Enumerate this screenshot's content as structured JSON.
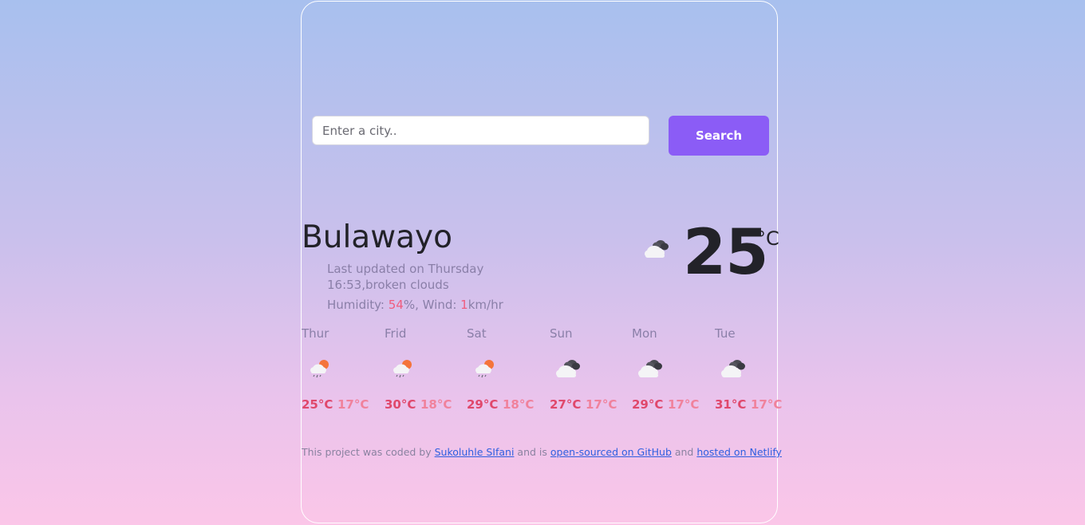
{
  "search": {
    "placeholder": "Enter a city..",
    "value": "",
    "button_label": "Search"
  },
  "current": {
    "city": "Bulawayo",
    "updated_prefix": "Last updated on Thursday",
    "updated_time": "16:53",
    "description": "broken clouds",
    "humidity_label": "Humidity: ",
    "humidity_value": "54",
    "humidity_unit": "%",
    "wind_label": ", Wind: ",
    "wind_value": "1",
    "wind_unit": "km/hr",
    "temperature": "25",
    "unit": "°C",
    "icon": "broken-clouds-icon"
  },
  "forecast": [
    {
      "day": "Thur",
      "max": "25°C",
      "min": "17°C",
      "icon": "rain-sun-icon"
    },
    {
      "day": "Frid",
      "max": "30°C",
      "min": "18°C",
      "icon": "rain-sun-icon"
    },
    {
      "day": "Sat",
      "max": "29°C",
      "min": "18°C",
      "icon": "rain-sun-icon"
    },
    {
      "day": "Sun",
      "max": "27°C",
      "min": "17°C",
      "icon": "broken-clouds-icon"
    },
    {
      "day": "Mon",
      "max": "29°C",
      "min": "17°C",
      "icon": "broken-clouds-icon"
    },
    {
      "day": "Tue",
      "max": "31°C",
      "min": "17°C",
      "icon": "broken-clouds-icon"
    }
  ],
  "footer": {
    "text1": "This project was coded by ",
    "author_link": "Sukoluhle SIfani",
    "text2": " and is ",
    "github_link": "open-sourced on GitHub",
    "text3": " and ",
    "netlify_link": "hosted on Netlify"
  },
  "colors": {
    "accent": "#8b5cf6",
    "highlight": "#f05c7e",
    "link": "#2f5fe0"
  }
}
